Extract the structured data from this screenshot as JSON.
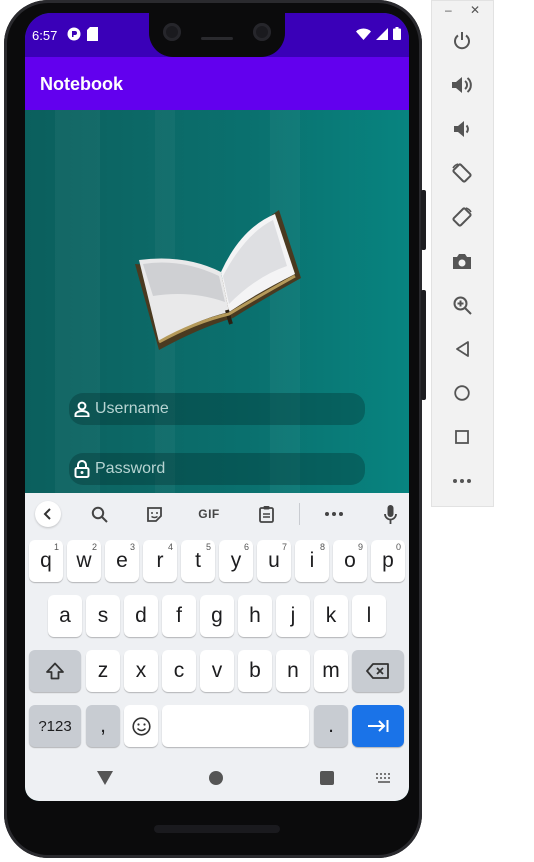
{
  "status": {
    "time": "6:57"
  },
  "app": {
    "title": "Notebook"
  },
  "login": {
    "username_placeholder": "Username",
    "password_placeholder": "Password"
  },
  "keyboard": {
    "suggestion_gif": "GIF",
    "row1": [
      {
        "key": "q",
        "hint": "1"
      },
      {
        "key": "w",
        "hint": "2"
      },
      {
        "key": "e",
        "hint": "3"
      },
      {
        "key": "r",
        "hint": "4"
      },
      {
        "key": "t",
        "hint": "5"
      },
      {
        "key": "y",
        "hint": "6"
      },
      {
        "key": "u",
        "hint": "7"
      },
      {
        "key": "i",
        "hint": "8"
      },
      {
        "key": "o",
        "hint": "9"
      },
      {
        "key": "p",
        "hint": "0"
      }
    ],
    "row2": [
      "a",
      "s",
      "d",
      "f",
      "g",
      "h",
      "j",
      "k",
      "l"
    ],
    "row3": [
      "z",
      "x",
      "c",
      "v",
      "b",
      "n",
      "m"
    ],
    "symbols_label": "?123",
    "comma_label": ",",
    "period_label": "."
  },
  "emulator_panel": {
    "minimize_label": "–",
    "close_label": "✕"
  },
  "colors": {
    "status_bar": "#3a00b8",
    "app_bar": "#6200ee",
    "content_bg": "#0a716f",
    "enter_key": "#1a73e8"
  }
}
